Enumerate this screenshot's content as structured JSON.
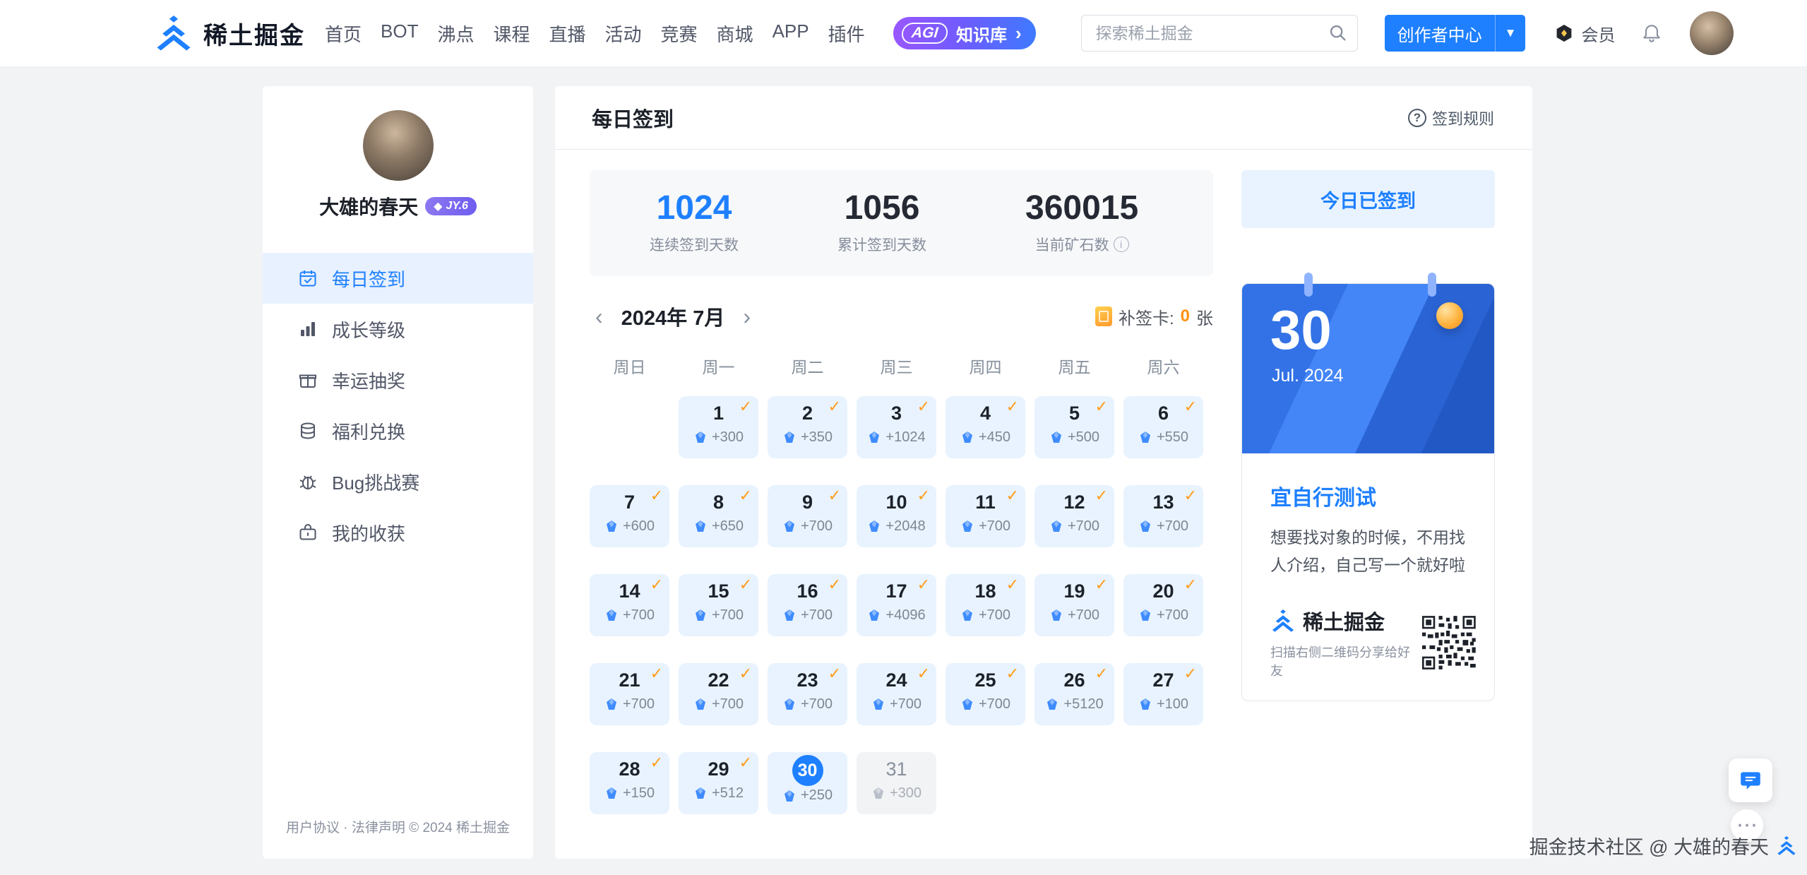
{
  "navbar": {
    "brand": "稀土掘金",
    "items": [
      {
        "key": "home",
        "label": "首页"
      },
      {
        "key": "bot",
        "label": "BOT"
      },
      {
        "key": "pins",
        "label": "沸点"
      },
      {
        "key": "course",
        "label": "课程"
      },
      {
        "key": "live",
        "label": "直播"
      },
      {
        "key": "events",
        "label": "活动"
      },
      {
        "key": "contest",
        "label": "竞赛"
      },
      {
        "key": "shop",
        "label": "商城"
      },
      {
        "key": "app",
        "label": "APP"
      },
      {
        "key": "extension",
        "label": "插件"
      }
    ],
    "agi_badge": {
      "tag": "AGI",
      "label": "知识库",
      "arrow": "›"
    },
    "search": {
      "placeholder": "探索稀土掘金"
    },
    "creator_button": "创作者中心",
    "member_label": "会员"
  },
  "sidebar": {
    "username": "大雄的春天",
    "badge": "JY.6",
    "menu": [
      {
        "key": "daily-checkin",
        "icon": "calendar-check-icon",
        "label": "每日签到",
        "active": true
      },
      {
        "key": "growth-level",
        "icon": "chart-icon",
        "label": "成长等级",
        "active": false
      },
      {
        "key": "lucky-draw",
        "icon": "lottery-icon",
        "label": "幸运抽奖",
        "active": false
      },
      {
        "key": "welfare-exchange",
        "icon": "coins-icon",
        "label": "福利兑换",
        "active": false
      },
      {
        "key": "bug-challenge",
        "icon": "bug-icon",
        "label": "Bug挑战赛",
        "active": false
      },
      {
        "key": "my-harvest",
        "icon": "harvest-icon",
        "label": "我的收获",
        "active": false
      }
    ],
    "footer": "用户协议 · 法律声明 © 2024 稀土掘金"
  },
  "main": {
    "title": "每日签到",
    "rules_link": "签到规则",
    "stats": [
      {
        "key": "continuous-days",
        "value": "1024",
        "label": "连续签到天数",
        "highlight": true,
        "info": false
      },
      {
        "key": "total-days",
        "value": "1056",
        "label": "累计签到天数",
        "highlight": false,
        "info": false
      },
      {
        "key": "ore-count",
        "value": "360015",
        "label": "当前矿石数",
        "highlight": false,
        "info": true
      }
    ],
    "calendar": {
      "month_label": "2024年 7月",
      "resign_card": {
        "label": "补签卡:",
        "count": "0",
        "unit": "张"
      },
      "weekdays": [
        "周日",
        "周一",
        "周二",
        "周三",
        "周四",
        "周五",
        "周六"
      ],
      "days": [
        {
          "empty": true
        },
        {
          "day": "1",
          "amount": "+300",
          "state": "checked"
        },
        {
          "day": "2",
          "amount": "+350",
          "state": "checked"
        },
        {
          "day": "3",
          "amount": "+1024",
          "state": "checked"
        },
        {
          "day": "4",
          "amount": "+450",
          "state": "checked"
        },
        {
          "day": "5",
          "amount": "+500",
          "state": "checked"
        },
        {
          "day": "6",
          "amount": "+550",
          "state": "checked"
        },
        {
          "day": "7",
          "amount": "+600",
          "state": "checked"
        },
        {
          "day": "8",
          "amount": "+650",
          "state": "checked"
        },
        {
          "day": "9",
          "amount": "+700",
          "state": "checked"
        },
        {
          "day": "10",
          "amount": "+2048",
          "state": "checked"
        },
        {
          "day": "11",
          "amount": "+700",
          "state": "checked"
        },
        {
          "day": "12",
          "amount": "+700",
          "state": "checked"
        },
        {
          "day": "13",
          "amount": "+700",
          "state": "checked"
        },
        {
          "day": "14",
          "amount": "+700",
          "state": "checked"
        },
        {
          "day": "15",
          "amount": "+700",
          "state": "checked"
        },
        {
          "day": "16",
          "amount": "+700",
          "state": "checked"
        },
        {
          "day": "17",
          "amount": "+4096",
          "state": "checked"
        },
        {
          "day": "18",
          "amount": "+700",
          "state": "checked"
        },
        {
          "day": "19",
          "amount": "+700",
          "state": "checked"
        },
        {
          "day": "20",
          "amount": "+700",
          "state": "checked"
        },
        {
          "day": "21",
          "amount": "+700",
          "state": "checked"
        },
        {
          "day": "22",
          "amount": "+700",
          "state": "checked"
        },
        {
          "day": "23",
          "amount": "+700",
          "state": "checked"
        },
        {
          "day": "24",
          "amount": "+700",
          "state": "checked"
        },
        {
          "day": "25",
          "amount": "+700",
          "state": "checked"
        },
        {
          "day": "26",
          "amount": "+5120",
          "state": "checked"
        },
        {
          "day": "27",
          "amount": "+100",
          "state": "checked"
        },
        {
          "day": "28",
          "amount": "+150",
          "state": "checked"
        },
        {
          "day": "29",
          "amount": "+512",
          "state": "checked"
        },
        {
          "day": "30",
          "amount": "+250",
          "state": "today"
        },
        {
          "day": "31",
          "amount": "+300",
          "state": "future"
        }
      ]
    }
  },
  "aside": {
    "signed_button": "今日已签到",
    "card": {
      "day": "30",
      "date": "Jul. 2024",
      "title": "宜自行测试",
      "text": "想要找对象的时候，不用找人介绍，自己写一个就好啦",
      "brand": "稀土掘金",
      "share_tip": "扫描右侧二维码分享给好友"
    }
  },
  "floating": {
    "watermark": "掘金技术社区 @ 大雄的春天"
  },
  "colors": {
    "accent": "#1e80ff",
    "check": "#ff9c1b",
    "member_badge": "#f7c84b"
  }
}
